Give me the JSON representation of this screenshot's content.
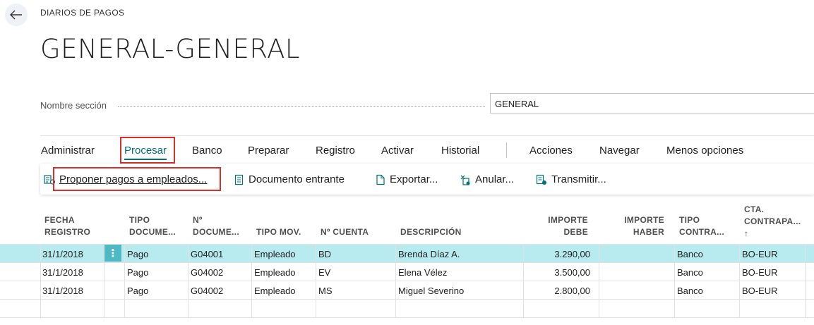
{
  "breadcrumb": "DIARIOS DE PAGOS",
  "page_title": "GENERAL-GENERAL",
  "section_field": {
    "label": "Nombre sección",
    "value": "GENERAL"
  },
  "menu": {
    "items": [
      "Administrar",
      "Procesar",
      "Banco",
      "Preparar",
      "Registro",
      "Activar",
      "Historial"
    ],
    "right_items": [
      "Acciones",
      "Navegar",
      "Menos opciones"
    ],
    "active": "Procesar"
  },
  "subactions": [
    {
      "label": "Proponer pagos a empleados...",
      "icon": "suggest-payments-icon"
    },
    {
      "label": "Documento entrante",
      "icon": "incoming-document-icon"
    },
    {
      "label": "Exportar...",
      "icon": "export-icon"
    },
    {
      "label": "Anular...",
      "icon": "void-icon"
    },
    {
      "label": "Transmitir...",
      "icon": "transmit-icon"
    }
  ],
  "table": {
    "headers": {
      "fecha_1": "FECHA",
      "fecha_2": "REGISTRO",
      "tipo_doc_1": "TIPO",
      "tipo_doc_2": "DOCUME...",
      "num_doc_1": "Nº",
      "num_doc_2": "DOCUME...",
      "tipo_mov": "TIPO MOV.",
      "num_cuenta": "Nº CUENTA",
      "descripcion": "DESCRIPCIÓN",
      "debe_1": "IMPORTE",
      "debe_2": "DEBE",
      "haber_1": "IMPORTE",
      "haber_2": "HABER",
      "tipo_contra_1": "TIPO",
      "tipo_contra_2": "CONTRA...",
      "cta_1": "CTA.",
      "cta_2": "CONTRAPA...",
      "cta_sort": "↑"
    },
    "rows": [
      {
        "fecha": "31/1/2018",
        "tipo_doc": "Pago",
        "num_doc": "G04001",
        "tipo_mov": "Empleado",
        "cuenta": "BD",
        "descripcion": "Brenda Díaz A.",
        "debe": "3.290,00",
        "haber": "",
        "tipo_contra": "Banco",
        "cta_contra": "BO-EUR"
      },
      {
        "fecha": "31/1/2018",
        "tipo_doc": "Pago",
        "num_doc": "G04002",
        "tipo_mov": "Empleado",
        "cuenta": "EV",
        "descripcion": "Elena Vélez",
        "debe": "3.500,00",
        "haber": "",
        "tipo_contra": "Banco",
        "cta_contra": "BO-EUR"
      },
      {
        "fecha": "31/1/2018",
        "tipo_doc": "Pago",
        "num_doc": "G04002",
        "tipo_mov": "Empleado",
        "cuenta": "MS",
        "descripcion": "Miguel Severino",
        "debe": "2.800,00",
        "haber": "",
        "tipo_contra": "Banco",
        "cta_contra": "BO-EUR"
      }
    ]
  },
  "colors": {
    "accent": "#00707a",
    "selected_row": "#b7ebef",
    "highlight_box": "#d9302b"
  },
  "icons": {
    "back": "back-arrow-icon",
    "row_menu": "kebab-menu-icon"
  }
}
